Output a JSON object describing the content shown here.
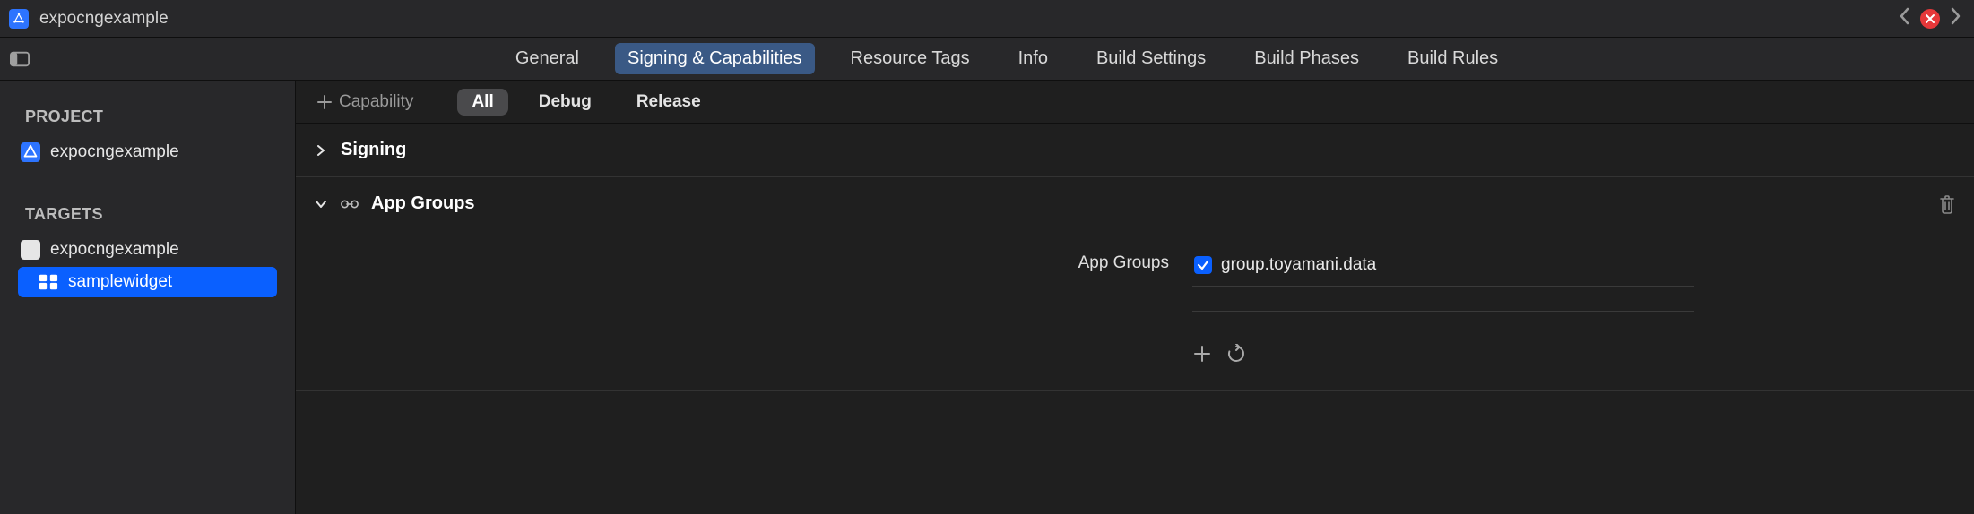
{
  "titlebar": {
    "project_name": "expocngexample"
  },
  "editor_tabs": [
    {
      "label": "General",
      "active": false
    },
    {
      "label": "Signing & Capabilities",
      "active": true
    },
    {
      "label": "Resource Tags",
      "active": false
    },
    {
      "label": "Info",
      "active": false
    },
    {
      "label": "Build Settings",
      "active": false
    },
    {
      "label": "Build Phases",
      "active": false
    },
    {
      "label": "Build Rules",
      "active": false
    }
  ],
  "sidebar": {
    "project_header": "PROJECT",
    "project_item": "expocngexample",
    "targets_header": "TARGETS",
    "targets": [
      {
        "label": "expocngexample",
        "selected": false,
        "icon": "app"
      },
      {
        "label": "samplewidget",
        "selected": true,
        "icon": "widget"
      }
    ]
  },
  "filterbar": {
    "capability_label": "Capability",
    "schemes": [
      {
        "label": "All",
        "active": true
      },
      {
        "label": "Debug",
        "active": false
      },
      {
        "label": "Release",
        "active": false
      }
    ]
  },
  "sections": {
    "signing": {
      "title": "Signing",
      "expanded": false
    },
    "app_groups": {
      "title": "App Groups",
      "expanded": true,
      "field_label": "App Groups",
      "items": [
        {
          "value": "group.toyamani.data",
          "checked": true
        }
      ]
    }
  }
}
